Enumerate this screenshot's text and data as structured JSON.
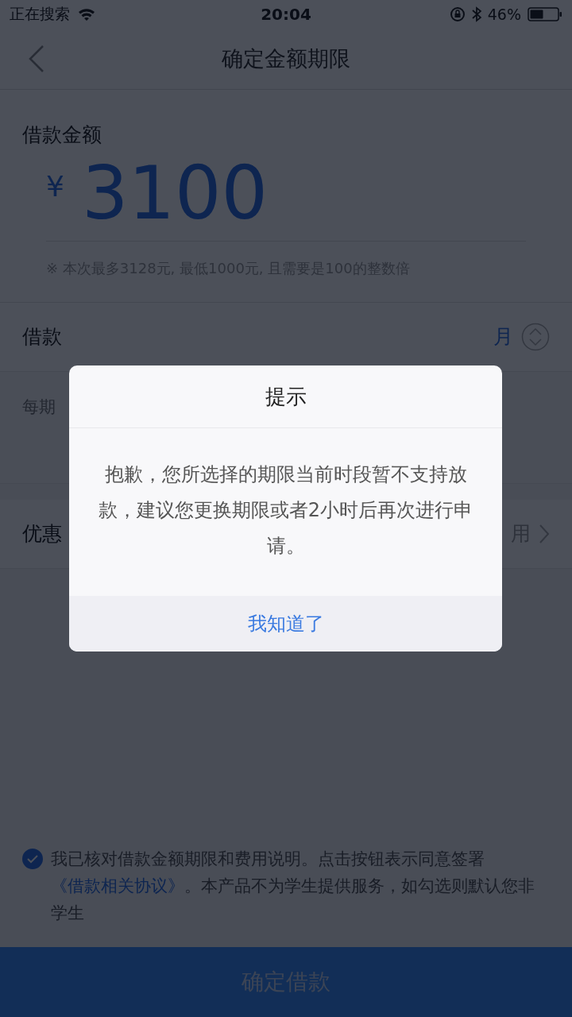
{
  "status_bar": {
    "carrier": "正在搜索",
    "time": "20:04",
    "battery": "46%"
  },
  "nav": {
    "title": "确定金额期限"
  },
  "amount": {
    "label": "借款金额",
    "currency": "¥",
    "value": "3100",
    "hint": "※ 本次最多3128元, 最低1000元, 且需要是100的整数倍"
  },
  "rows": [
    {
      "kind": "select",
      "label": "借款",
      "value": "月"
    },
    {
      "kind": "info",
      "label": "每期"
    },
    {
      "kind": "link",
      "label": "优惠",
      "value": "用"
    }
  ],
  "agreement": {
    "checked": true,
    "text": "我已核对借款金额期限和费用说明。点击按钮表示同意签署",
    "link": "《借款相关协议》",
    "text_after": "。本产品不为学生提供服务，如勾选则默认您非学生"
  },
  "submit": "确定借款",
  "dialog": {
    "title": "提示",
    "message": "抱歉，您所选择的期限当前时段暂不支持放款，建议您更换期限或者2小时后再次进行申请。",
    "button": "我知道了"
  }
}
